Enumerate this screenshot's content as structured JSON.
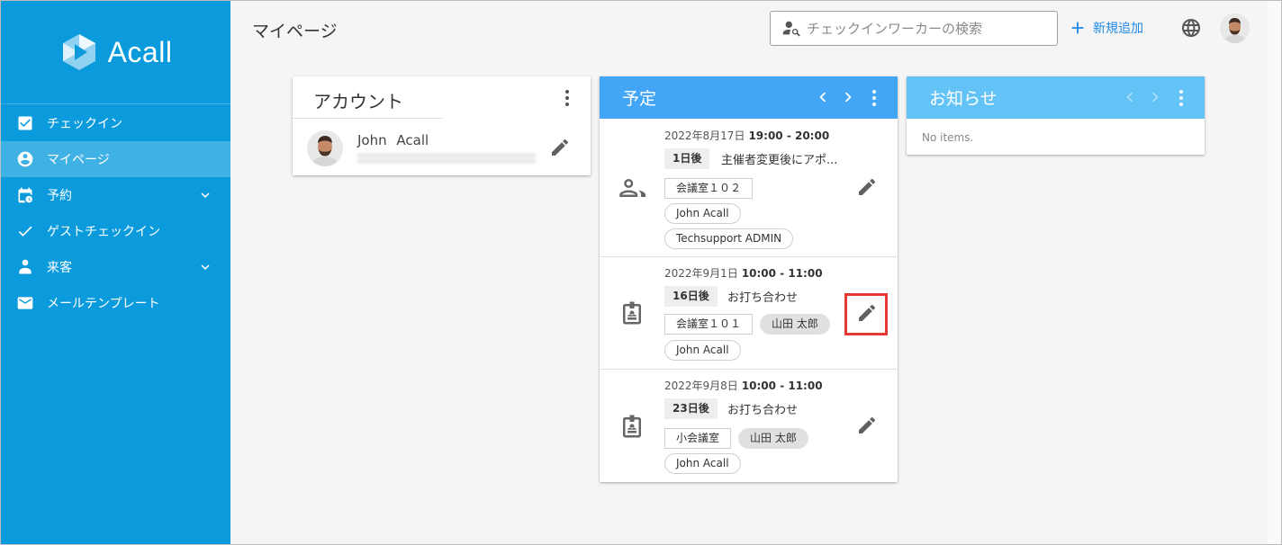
{
  "brand": {
    "name": "Acall"
  },
  "sidebar": {
    "items": [
      {
        "label": "チェックイン",
        "icon": "checkbox-icon"
      },
      {
        "label": "マイページ",
        "icon": "account-circle-icon",
        "active": true
      },
      {
        "label": "予約",
        "icon": "calendar-icon",
        "expandable": true
      },
      {
        "label": "ゲストチェックイン",
        "icon": "check-icon"
      },
      {
        "label": "来客",
        "icon": "visitor-icon",
        "expandable": true
      },
      {
        "label": "メールテンプレート",
        "icon": "mail-icon"
      }
    ]
  },
  "header": {
    "title": "マイページ",
    "search_placeholder": "チェックインワーカーの検索",
    "add_label": "新規追加"
  },
  "account": {
    "title": "アカウント",
    "name": "John Acall"
  },
  "schedule": {
    "title": "予定",
    "events": [
      {
        "date": "2022年8月17日",
        "time": "19:00 - 20:00",
        "days": "1日後",
        "title": "主催者変更後にアポ...",
        "chips": [
          "会議室１０２",
          "John Acall",
          "Techsupport ADMIN"
        ],
        "icon": "people-icon"
      },
      {
        "date": "2022年9月1日",
        "time": "10:00 - 11:00",
        "days": "16日後",
        "title": "お打ち合わせ",
        "chips": [
          "会議室１０１",
          "山田 太郎",
          "John Acall"
        ],
        "icon": "badge-icon"
      },
      {
        "date": "2022年9月8日",
        "time": "10:00 - 11:00",
        "days": "23日後",
        "title": "お打ち合わせ",
        "chips": [
          "小会議室",
          "山田 太郎",
          "John Acall"
        ],
        "icon": "badge-icon"
      }
    ]
  },
  "notices": {
    "title": "お知らせ",
    "empty_text": "No items."
  },
  "colors": {
    "sidebar": "#0b9bdd",
    "schedule_header": "#42a5f5",
    "notice_header": "#64c3f6",
    "accent": "#1e88e5",
    "highlight": "#e53935"
  }
}
